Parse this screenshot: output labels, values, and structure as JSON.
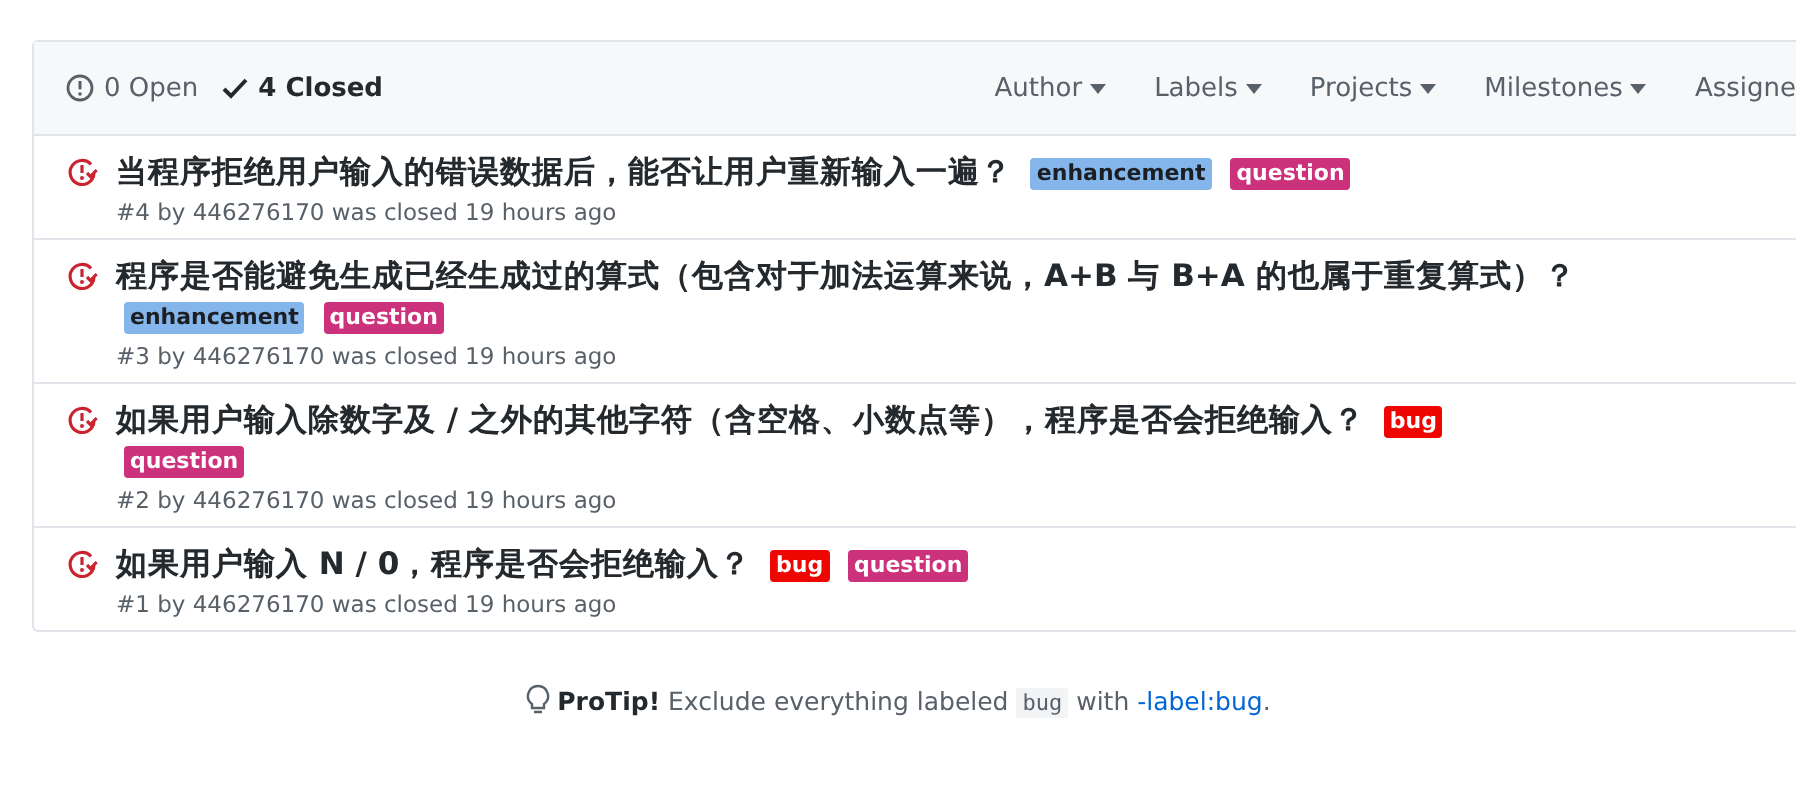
{
  "states": [
    {
      "label": "0 Open",
      "selected": false
    },
    {
      "label": "4 Closed",
      "selected": true
    }
  ],
  "filters": [
    "Author",
    "Labels",
    "Projects",
    "Milestones",
    "Assigne"
  ],
  "issues": [
    {
      "title": "当程序拒绝用户输入的错误数据后，能否让用户重新输入一遍？",
      "labels": [
        {
          "name": "enhancement",
          "color": "#84b6eb"
        },
        {
          "name": "question",
          "color": "#cc317c"
        }
      ],
      "meta": "#4 by 446276170 was closed 19 hours ago"
    },
    {
      "title": "程序是否能避免生成已经生成过的算式（包含对于加法运算来说，A+B 与 B+A 的也属于重复算式）？",
      "labels": [
        {
          "name": "enhancement",
          "color": "#84b6eb"
        },
        {
          "name": "question",
          "color": "#cc317c"
        }
      ],
      "meta": "#3 by 446276170 was closed 19 hours ago"
    },
    {
      "title": "如果用户输入除数字及 / 之外的其他字符（含空格、小数点等），程序是否会拒绝输入？",
      "labels": [
        {
          "name": "bug",
          "color": "#ee0701"
        },
        {
          "name": "question",
          "color": "#cc317c"
        }
      ],
      "meta": "#2 by 446276170 was closed 19 hours ago"
    },
    {
      "title": "如果用户输入 N / 0，程序是否会拒绝输入？",
      "labels": [
        {
          "name": "bug",
          "color": "#ee0701"
        },
        {
          "name": "question",
          "color": "#cc317c"
        }
      ],
      "meta": "#1 by 446276170 was closed 19 hours ago"
    }
  ],
  "protip": {
    "lead": "ProTip!",
    "text": "Exclude everything labeled",
    "code": "bug",
    "middle": "with",
    "link": "-label:bug",
    "end": "."
  }
}
